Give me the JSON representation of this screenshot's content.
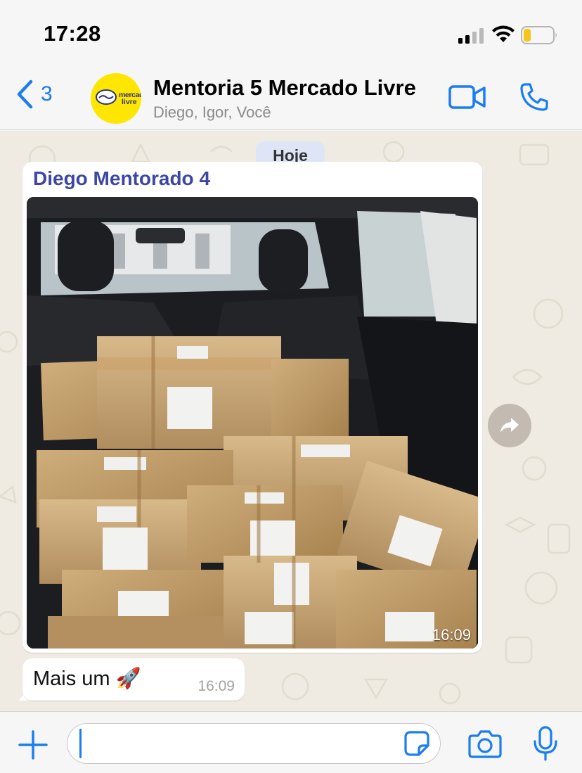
{
  "status_bar": {
    "time": "17:28",
    "battery_level_fraction": 0.25,
    "battery_color": "#f5c518"
  },
  "header": {
    "back_count": "3",
    "avatar_text_line1": "mercado",
    "avatar_text_line2": "livre",
    "title": "Mentoria 5 Mercado Livre",
    "subtitle": "Diego, Igor, Você",
    "accent_color": "#1a7ef0",
    "icons": [
      "chevron-left-icon",
      "video-icon",
      "phone-icon"
    ]
  },
  "chat": {
    "date_label": "Hoje",
    "messages": [
      {
        "type": "image",
        "sender": "Diego Mentorado 4",
        "sender_color": "#3d47a3",
        "time": "16:09"
      },
      {
        "type": "text",
        "text": "Mais um",
        "emoji": "🚀",
        "time": "16:09"
      }
    ]
  },
  "input_bar": {
    "value": "",
    "icons": [
      "plus-icon",
      "sticker-icon",
      "camera-icon",
      "microphone-icon"
    ]
  }
}
